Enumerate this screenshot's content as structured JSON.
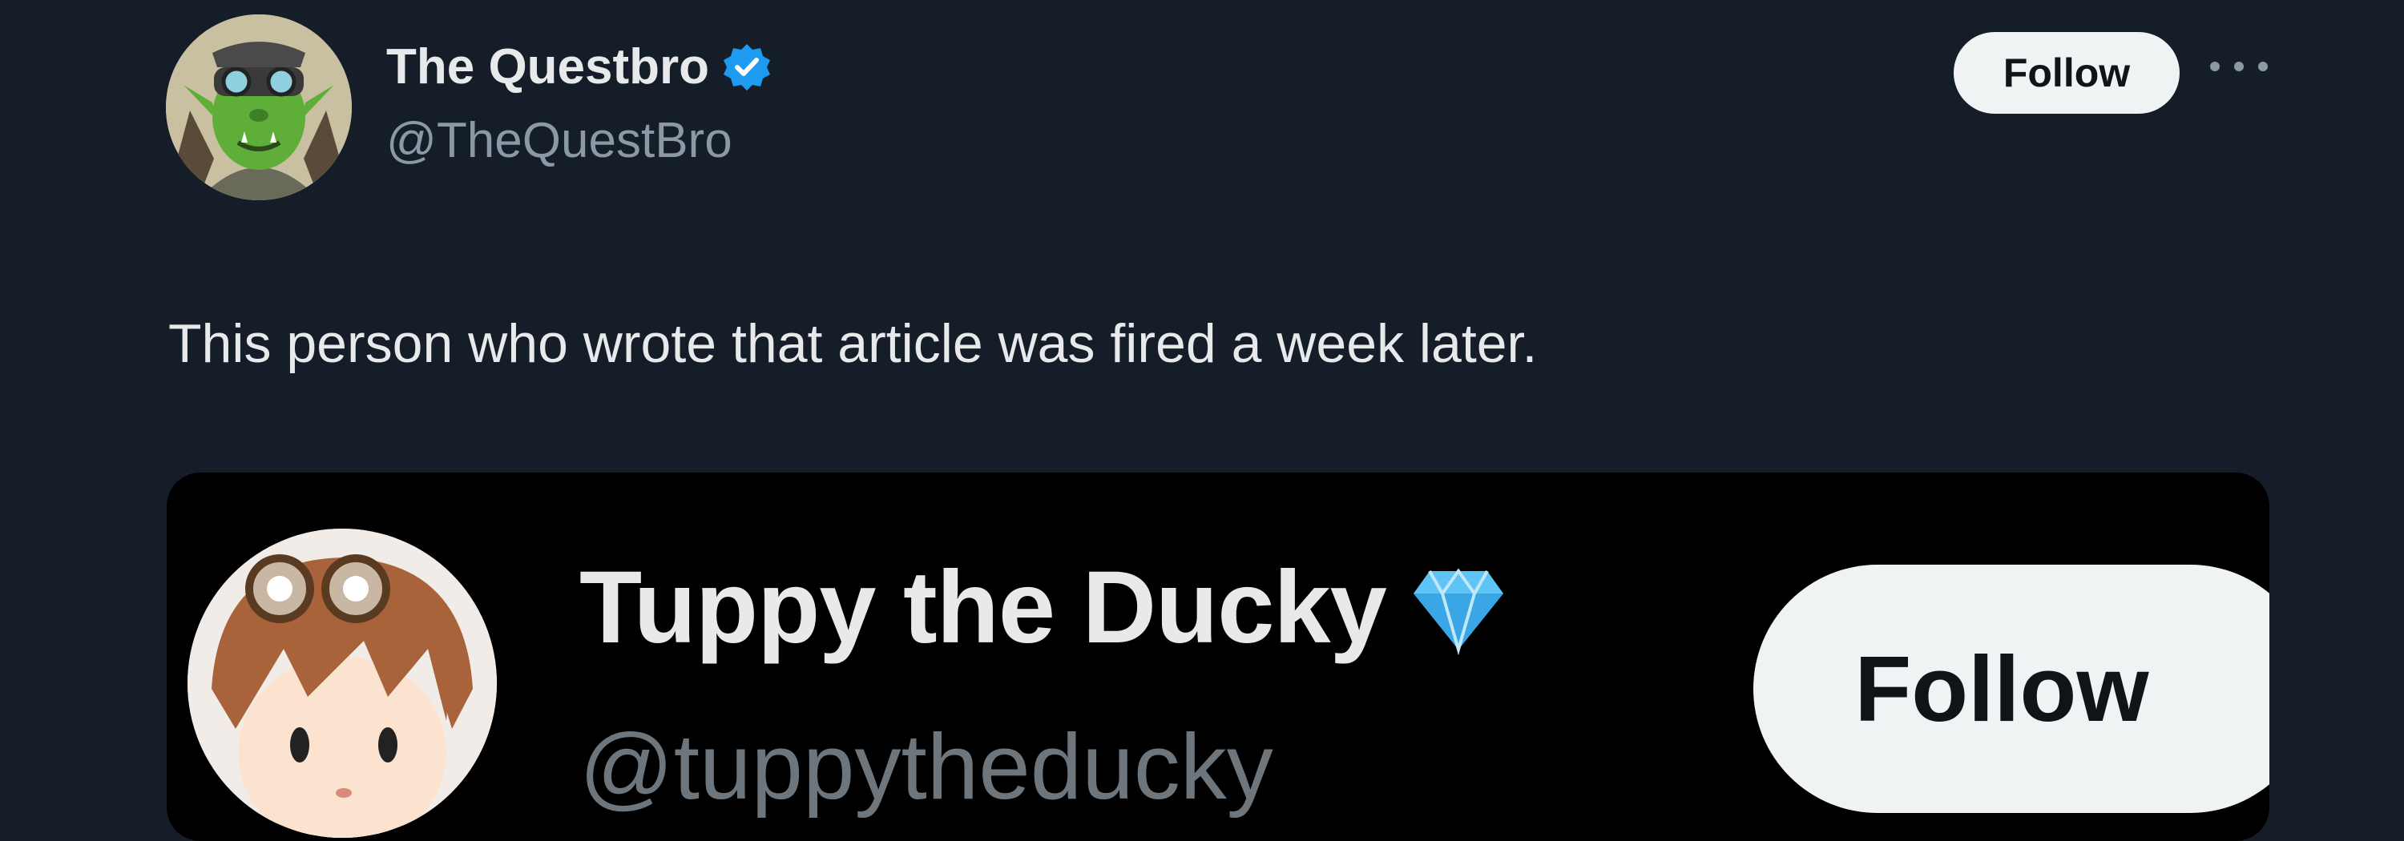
{
  "tweet": {
    "author": {
      "name": "The Questbro",
      "handle": "@TheQuestBro",
      "verified": true,
      "avatar": "orc-avatar-icon"
    },
    "follow_label": "Follow",
    "more_icon": "more-options-icon",
    "text": "This person who wrote that article was fired a week later."
  },
  "embedded": {
    "name": "Tuppy the Ducky",
    "badge_icon": "diamond-icon",
    "handle": "@tuppytheducky",
    "follow_label": "Follow",
    "avatar": "cartoon-boy-avatar-icon"
  },
  "colors": {
    "background": "#151d29",
    "card_background": "#000000",
    "verified_blue": "#1d9bf0",
    "gem_blue": "#5ec3f5",
    "button_bg": "#eff3f4",
    "secondary_text": "#8b98a5"
  }
}
